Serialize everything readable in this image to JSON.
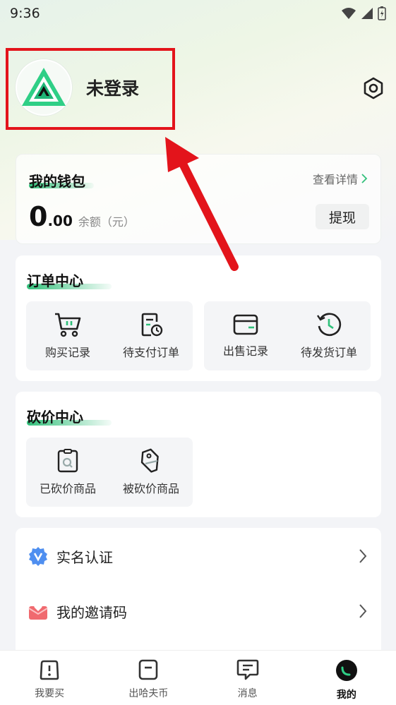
{
  "status_bar": {
    "time": "9:36"
  },
  "profile": {
    "name": "未登录"
  },
  "wallet": {
    "title": "我的钱包",
    "detail_link": "查看详情",
    "balance_int": "0",
    "balance_dec": ".00",
    "balance_label": "余额（元）",
    "withdraw": "提现"
  },
  "order_center": {
    "title": "订单中心",
    "items": [
      {
        "label": "购买记录",
        "icon": "cart-icon"
      },
      {
        "label": "待支付订单",
        "icon": "pending-payment-icon"
      },
      {
        "label": "出售记录",
        "icon": "wallet-icon"
      },
      {
        "label": "待发货订单",
        "icon": "history-clock-icon"
      }
    ]
  },
  "bargain_center": {
    "title": "砍价中心",
    "items": [
      {
        "label": "已砍价商品",
        "icon": "bargained-icon"
      },
      {
        "label": "被砍价商品",
        "icon": "price-tag-icon"
      }
    ]
  },
  "menu": {
    "items": [
      {
        "label": "实名认证",
        "icon": "verified-icon"
      },
      {
        "label": "我的邀请码",
        "icon": "invite-envelope-icon"
      }
    ]
  },
  "tabbar": {
    "items": [
      {
        "label": "我要买",
        "icon": "buy-bag-icon"
      },
      {
        "label": "出哈夫币",
        "icon": "sell-bag-icon"
      },
      {
        "label": "消息",
        "icon": "message-icon"
      },
      {
        "label": "我的",
        "icon": "profile-tab-icon"
      }
    ],
    "active_index": 3
  },
  "colors": {
    "accent": "#33c07b",
    "annotation": "#e3141b"
  }
}
